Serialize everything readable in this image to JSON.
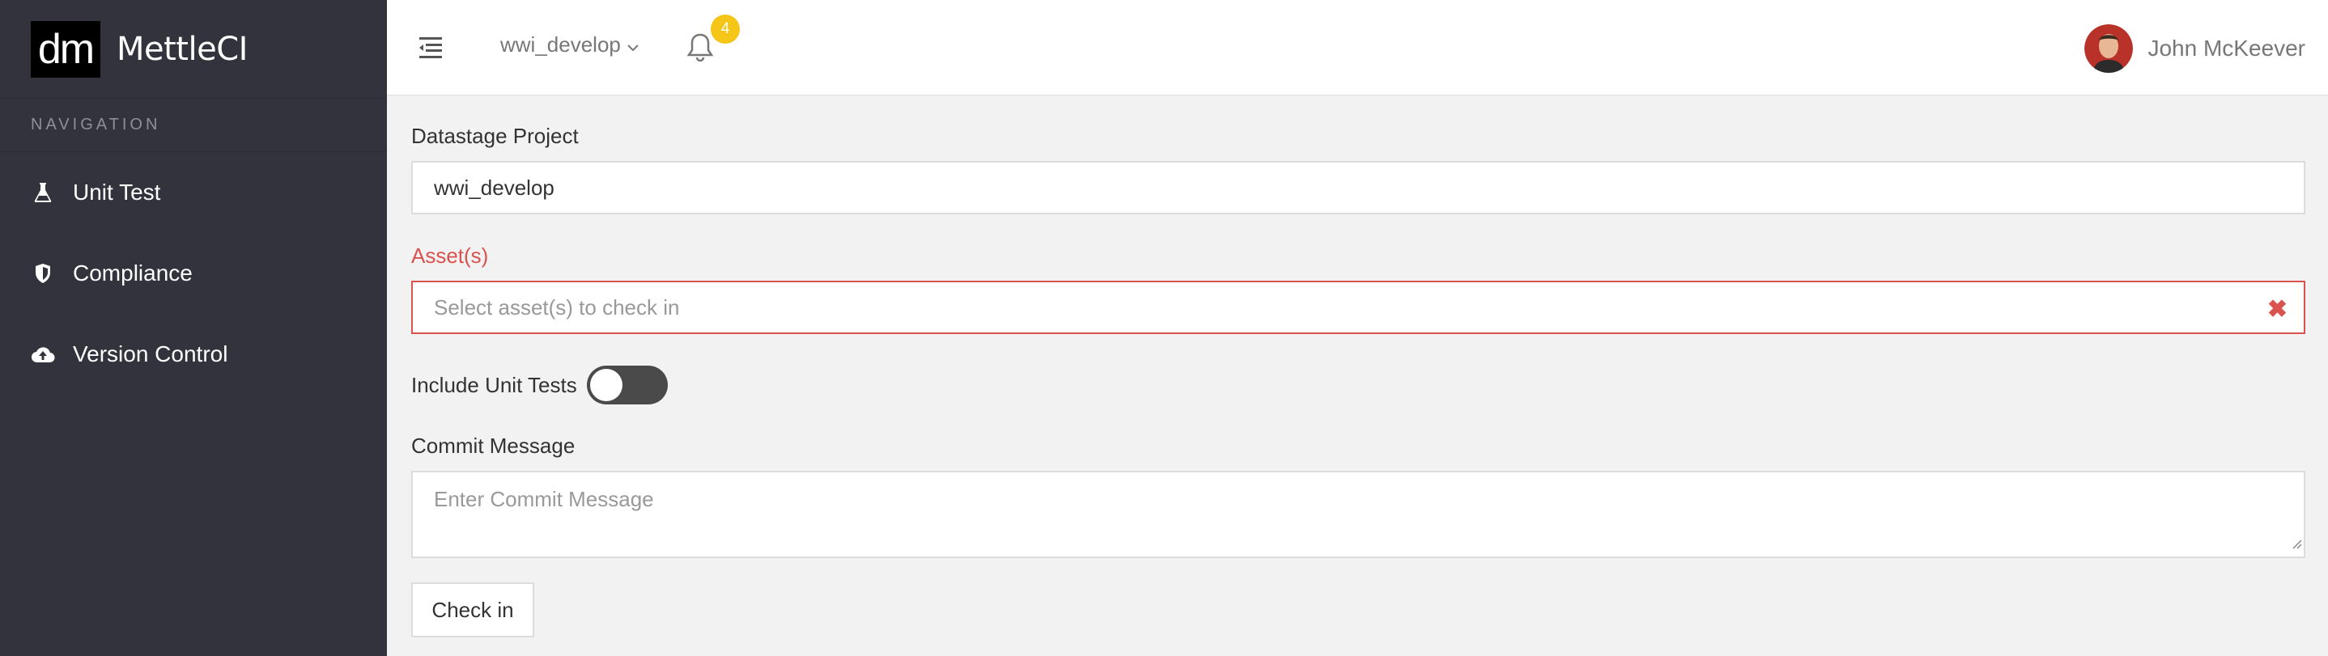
{
  "brand": {
    "logo_text": "dm",
    "name": "MettleCI"
  },
  "sidebar": {
    "header": "NAVIGATION",
    "items": [
      {
        "label": "Unit Test",
        "icon": "flask-icon"
      },
      {
        "label": "Compliance",
        "icon": "shield-icon"
      },
      {
        "label": "Version Control",
        "icon": "cloud-upload-icon"
      }
    ]
  },
  "topbar": {
    "project": "wwi_develop",
    "notification_count": "4",
    "user_name": "John McKeever"
  },
  "form": {
    "project_label": "Datastage Project",
    "project_value": "wwi_develop",
    "assets_label": "Asset(s)",
    "assets_placeholder": "Select asset(s) to check in",
    "include_tests_label": "Include Unit Tests",
    "include_tests_on": false,
    "commit_label": "Commit Message",
    "commit_placeholder": "Enter Commit Message",
    "submit_label": "Check in"
  },
  "colors": {
    "sidebar_bg": "#32333d",
    "error": "#d9534f",
    "badge": "#f5c518",
    "page_bg": "#f2f2f2"
  }
}
